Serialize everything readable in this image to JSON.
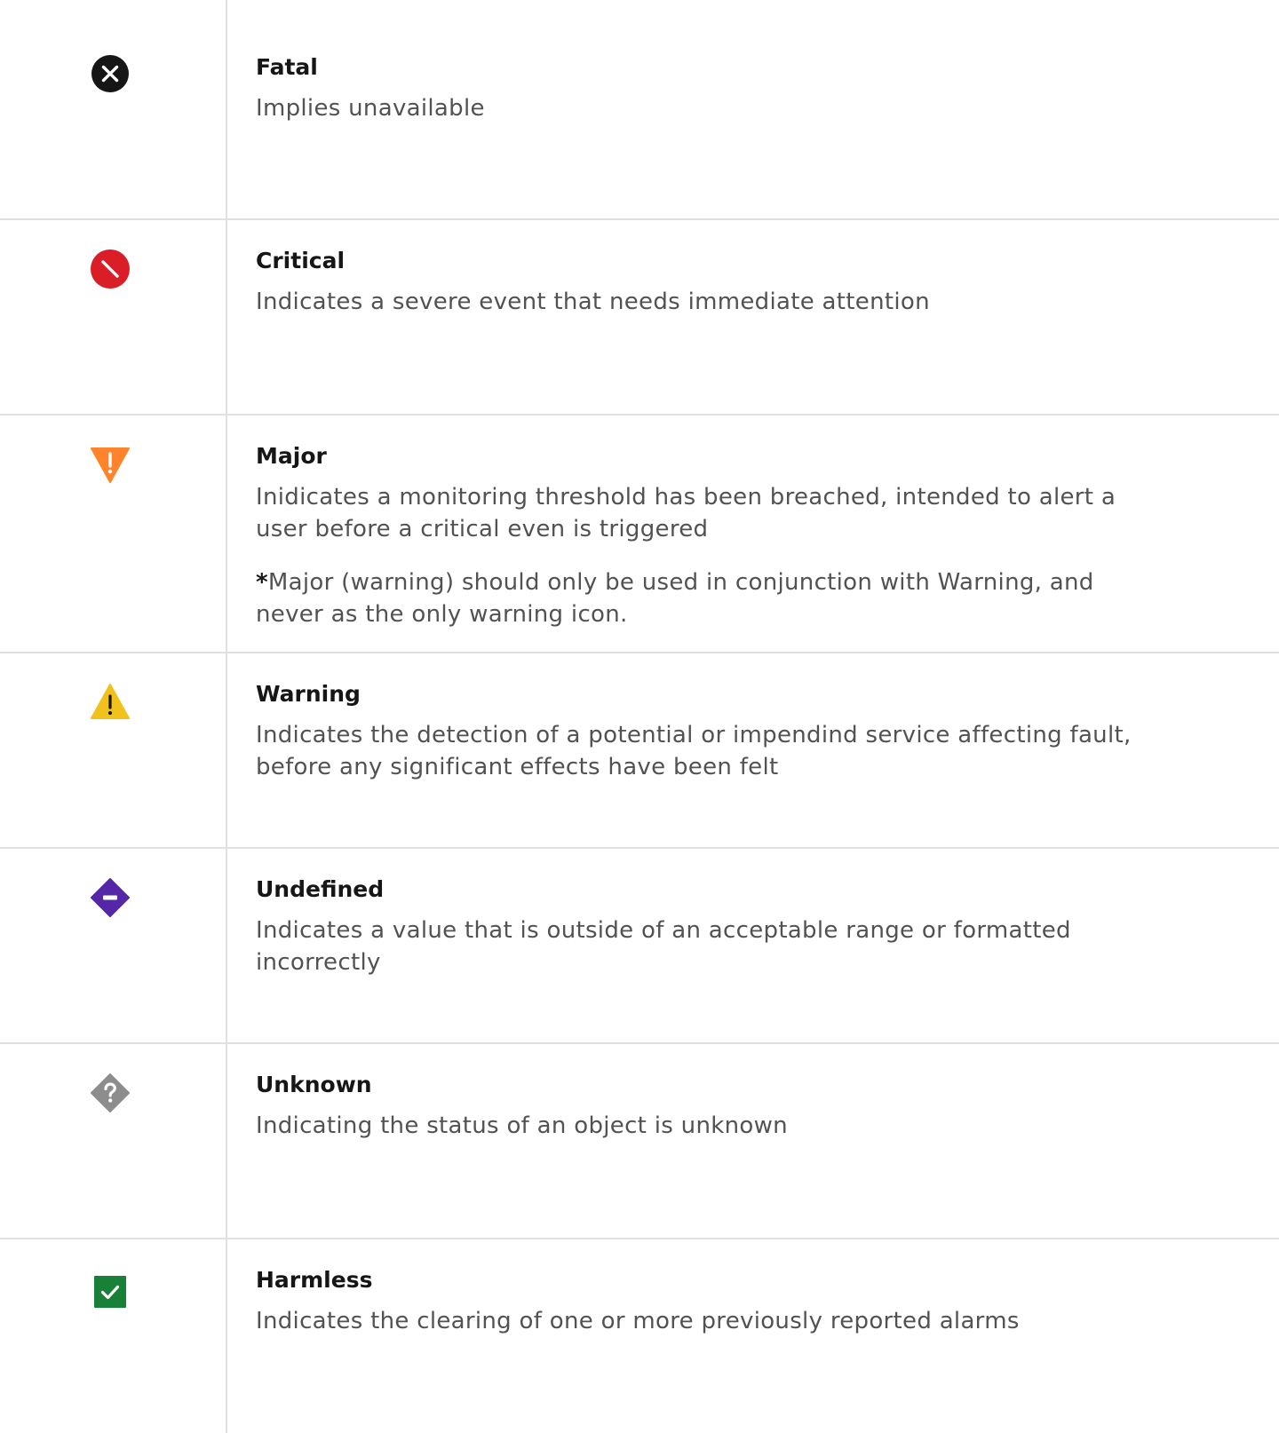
{
  "colors": {
    "fatal": "#161616",
    "critical": "#da1e28",
    "major": "#ff832b",
    "warning": "#f1c21b",
    "undefined": "#5526a8",
    "unknown": "#8d8d8d",
    "harmless": "#198038",
    "divider": "#e0e0e0",
    "title_text": "#161616",
    "body_text": "#525252"
  },
  "statuses": [
    {
      "icon": "fatal-x-circle-icon",
      "title": "Fatal",
      "description": "Implies unavailable"
    },
    {
      "icon": "critical-slash-circle-icon",
      "title": "Critical",
      "description": "Indicates a severe event that needs immediate attention"
    },
    {
      "icon": "major-inverted-triangle-icon",
      "title": "Major",
      "description": "Inidicates a monitoring threshold has been breached, intended to alert a user before a critical even is triggered",
      "note_asterisk": "*",
      "note": "Major (warning) should only be used in conjunction with Warning, and never as the only warning icon."
    },
    {
      "icon": "warning-triangle-icon",
      "title": "Warning",
      "description": "Indicates the detection of a potential or impendind service affecting fault, before any significant effects have been felt"
    },
    {
      "icon": "undefined-diamond-icon",
      "title": "Undefined",
      "description": "Indicates a value that is outside of an acceptable range or formatted incorrectly"
    },
    {
      "icon": "unknown-question-diamond-icon",
      "title": "Unknown",
      "description": "Indicating the status of an object is unknown"
    },
    {
      "icon": "harmless-checkmark-square-icon",
      "title": "Harmless",
      "description": "Indicates the clearing of one or more previously reported alarms"
    }
  ]
}
